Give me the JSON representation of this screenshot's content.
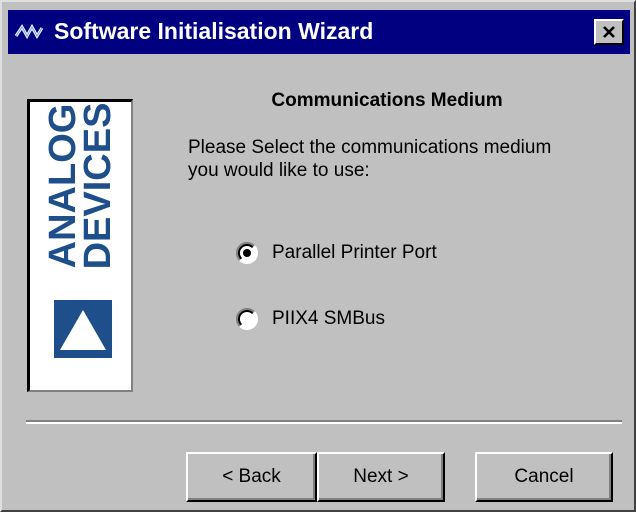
{
  "window": {
    "title": "Software Initialisation Wizard",
    "icon": "wave-icon",
    "close_icon": "close-icon"
  },
  "logo": {
    "line1": "ANALOG",
    "line2": "DEVICES",
    "color": "#1f4f8a"
  },
  "content": {
    "heading": "Communications Medium",
    "prompt_line1": "Please Select the communications medium",
    "prompt_line2": "you would like to use:"
  },
  "options": [
    {
      "label": "Parallel Printer Port",
      "selected": true
    },
    {
      "label": "PIIX4 SMBus",
      "selected": false
    }
  ],
  "buttons": {
    "back": "< Back",
    "next": "Next >",
    "cancel": "Cancel"
  },
  "colors": {
    "titlebar": "#000080",
    "face": "#c0c0c0",
    "brand": "#1f4f8a"
  }
}
